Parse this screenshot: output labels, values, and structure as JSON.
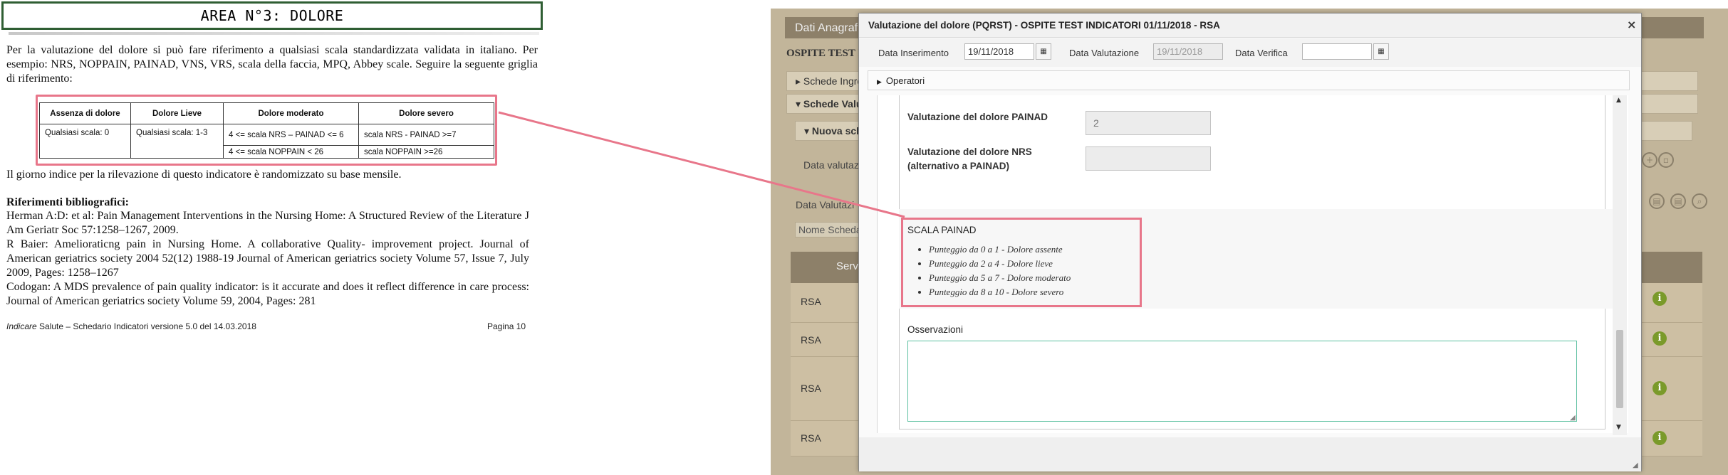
{
  "document": {
    "title": "AREA N°3: DOLORE",
    "intro": "Per la valutazione del dolore si può fare riferimento a qualsiasi scala standardizzata validata in italiano. Per esempio: NRS, NOPPAIN, PAINAD, VNS, VRS, scala della faccia, MPQ, Abbey scale. Seguire la seguente griglia di riferimento:",
    "table": {
      "headers": [
        "Assenza di dolore",
        "Dolore Lieve",
        "Dolore moderato",
        "Dolore severo"
      ],
      "row1": [
        "Qualsiasi scala: 0",
        "Qualsiasi scala: 1-3",
        "4 <=  scala NRS – PAINAD  <= 6",
        "scala NRS - PAINAD >=7"
      ],
      "row2": [
        "4 <= scala NOPPAIN < 26",
        "scala NOPPAIN >=26"
      ]
    },
    "note": "Il giorno indice per la rilevazione di questo indicatore è randomizzato su base mensile.",
    "refs_heading": "Riferimenti bibliografici:",
    "refs": [
      "Herman A:D: et al: Pain Management Interventions in the Nursing Home: A Structured Review of the Literature J Am Geriatr Soc 57:1258–1267, 2009.",
      "R Baier: Amelioraticng pain in Nursing Home. A collaborative Quality- improvement project. Journal of American geriatrics society 2004 52(12) 1988-19 Journal of American geriatrics society Volume 57, Issue 7, July 2009, Pages: 1258–1267",
      "Codogan: A MDS prevalence of pain quality indicator: is it accurate and does it reflect difference in care process: Journal of American geriatrics society Volume 59, 2004, Pages: 281"
    ],
    "footer_left_italic": "Indicare",
    "footer_left": " Salute – Schedario Indicatori versione 5.0 del 14.03.2018",
    "footer_right": "Pagina 10"
  },
  "background_app": {
    "header": "Dati Anagraf",
    "ospite": "OSPITE TEST I",
    "acc1": "Schede Ingre",
    "acc2": "Schede Valu",
    "acc3": "Nuova sch",
    "data_valutaz": "Data valutaz",
    "data_valutaz2": "Data Valutazi",
    "nome_scheda": "Nome Scheda",
    "table_head": "Serv",
    "rows": [
      "RSA",
      "RSA",
      "RSA",
      "RSA"
    ],
    "info_icon": "i"
  },
  "modal": {
    "title": "Valutazione del dolore (PQRST) - OSPITE TEST INDICATORI 01/11/2018 - RSA",
    "close": "×",
    "data_inserimento_label": "Data Inserimento",
    "data_inserimento_value": "19/11/2018",
    "data_valutazione_label": "Data Valutazione",
    "data_valutazione_value": "19/11/2018",
    "data_verifica_label": "Data Verifica",
    "data_verifica_value": "",
    "operatori": "Operatori",
    "painad_label": "Valutazione del dolore PAINAD",
    "painad_value": "2",
    "nrs_label_line1": "Valutazione del dolore NRS",
    "nrs_label_line2": "(alternativo a PAINAD)",
    "nrs_value": "",
    "scala_title": "SCALA PAINAD",
    "scala_items": [
      "Punteggio da 0 a 1 - Dolore assente",
      "Punteggio da 2 a 4 - Dolore lieve",
      "Punteggio da 5 a 7 - Dolore moderato",
      "Punteggio da 8 a 10 - Dolore severo"
    ],
    "osservazioni_label": "Osservazioni",
    "osservazioni_value": ""
  },
  "colors": {
    "highlight": "#e8768a",
    "title_border": "#2f5e33",
    "app_background": "#c2b59a",
    "textarea_border": "#5cc0a0"
  }
}
